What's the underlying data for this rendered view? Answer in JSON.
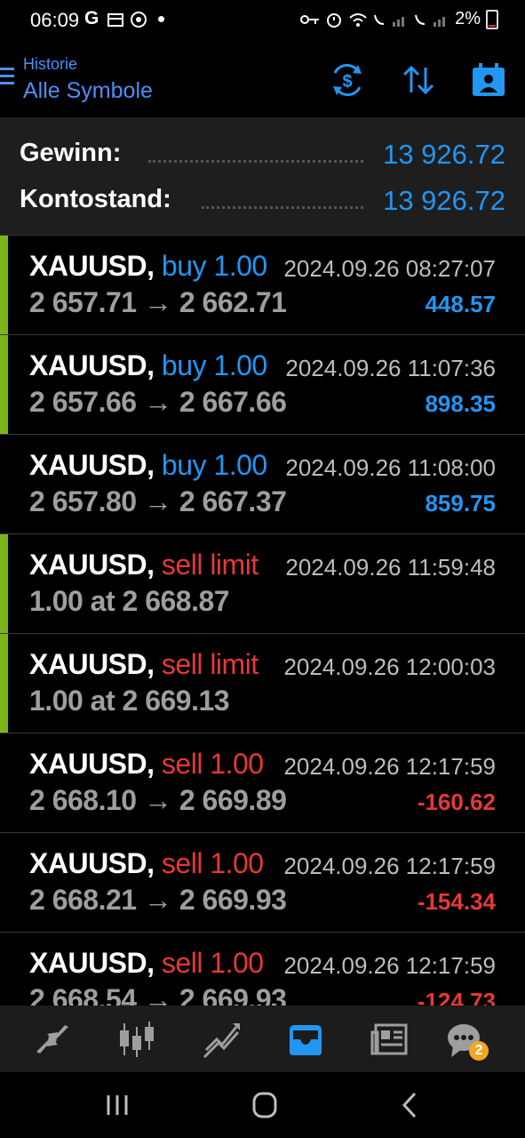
{
  "status_bar": {
    "time": "06:09",
    "left_icons": [
      "G",
      "calendar-icon",
      "timer-icon",
      "dot"
    ],
    "battery": "2%"
  },
  "header": {
    "subtitle": "Historie",
    "title": "Alle Symbole",
    "icons": [
      "dollar-exchange-icon",
      "sort-icon",
      "calendar-person-icon"
    ]
  },
  "summary": {
    "profit_label": "Gewinn:",
    "profit_value": "13 926.72",
    "balance_label": "Kontostand:",
    "balance_value": "13 926.72"
  },
  "orders": [
    {
      "symbol": "XAUUSD,",
      "side": "buy 1.00",
      "side_color": "blue",
      "time": "2024.09.26 08:27:07",
      "detail": "2 657.71 → 2 662.71",
      "profit": "448.57",
      "profit_color": "blue",
      "marker": true
    },
    {
      "symbol": "XAUUSD,",
      "side": "buy 1.00",
      "side_color": "blue",
      "time": "2024.09.26 11:07:36",
      "detail": "2 657.66 → 2 667.66",
      "profit": "898.35",
      "profit_color": "blue",
      "marker": true
    },
    {
      "symbol": "XAUUSD,",
      "side": "buy 1.00",
      "side_color": "blue",
      "time": "2024.09.26 11:08:00",
      "detail": "2 657.80 → 2 667.37",
      "profit": "859.75",
      "profit_color": "blue",
      "marker": false
    },
    {
      "symbol": "XAUUSD,",
      "side": "sell limit",
      "side_color": "red",
      "time": "2024.09.26 11:59:48",
      "detail": "1.00 at 2 668.87",
      "profit": "",
      "profit_color": "blue",
      "marker": true
    },
    {
      "symbol": "XAUUSD,",
      "side": "sell limit",
      "side_color": "red",
      "time": "2024.09.26 12:00:03",
      "detail": "1.00 at 2 669.13",
      "profit": "",
      "profit_color": "blue",
      "marker": true
    },
    {
      "symbol": "XAUUSD,",
      "side": "sell 1.00",
      "side_color": "red",
      "time": "2024.09.26 12:17:59",
      "detail": "2 668.10 → 2 669.89",
      "profit": "-160.62",
      "profit_color": "red",
      "marker": false
    },
    {
      "symbol": "XAUUSD,",
      "side": "sell 1.00",
      "side_color": "red",
      "time": "2024.09.26 12:17:59",
      "detail": "2 668.21 → 2 669.93",
      "profit": "-154.34",
      "profit_color": "red",
      "marker": false
    },
    {
      "symbol": "XAUUSD,",
      "side": "sell 1.00",
      "side_color": "red",
      "time": "2024.09.26 12:17:59",
      "detail": "2 668.54 → 2 669.93",
      "profit": "-124.73",
      "profit_color": "red",
      "marker": false
    }
  ],
  "bottom_nav": {
    "tabs": [
      "quotes-icon",
      "chart-candles-icon",
      "trade-icon",
      "history-inbox-icon",
      "news-icon",
      "chat-icon"
    ],
    "active": "history-inbox-icon",
    "chat_badge": "2"
  },
  "colors": {
    "accent": "#2196f3",
    "loss": "#e53935",
    "marker": "#7cb518",
    "summary_bg": "#1e1e1e"
  }
}
